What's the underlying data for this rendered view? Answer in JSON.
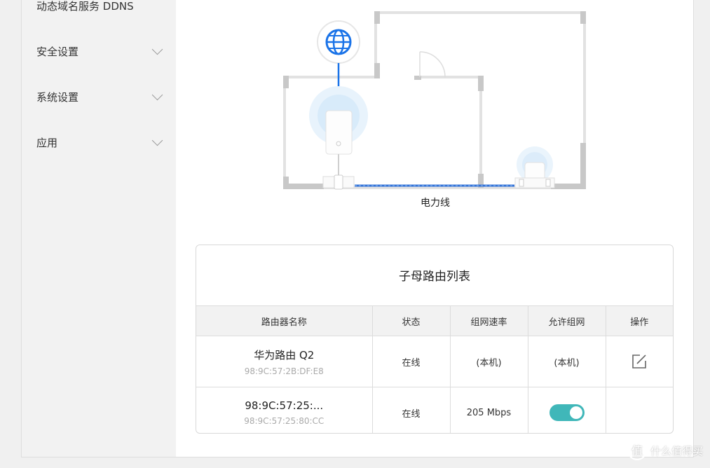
{
  "sidebar": {
    "items": [
      {
        "label": "动态域名服务 DDNS"
      },
      {
        "label": "安全设置"
      },
      {
        "label": "系统设置"
      },
      {
        "label": "应用"
      }
    ]
  },
  "diagram": {
    "caption": "电力线"
  },
  "router_list": {
    "title": "子母路由列表",
    "columns": [
      "路由器名称",
      "状态",
      "组网速率",
      "允许组网",
      "操作"
    ],
    "rows": [
      {
        "name": "华为路由 Q2",
        "mac": "98:9C:57:2B:DF:E8",
        "status": "在线",
        "rate": "(本机)",
        "allow": "(本机)",
        "action": "edit-icon"
      },
      {
        "name": "98:9C:57:25:...",
        "mac": "98:9C:57:25:80:CC",
        "status": "在线",
        "rate": "205 Mbps",
        "allow_toggle": true,
        "action": ""
      }
    ]
  },
  "watermark": {
    "text": "什么值得买"
  },
  "colors": {
    "accent": "#1a73e8",
    "toggle_on": "#40b7b9",
    "powerline": "#2f6fd6"
  }
}
